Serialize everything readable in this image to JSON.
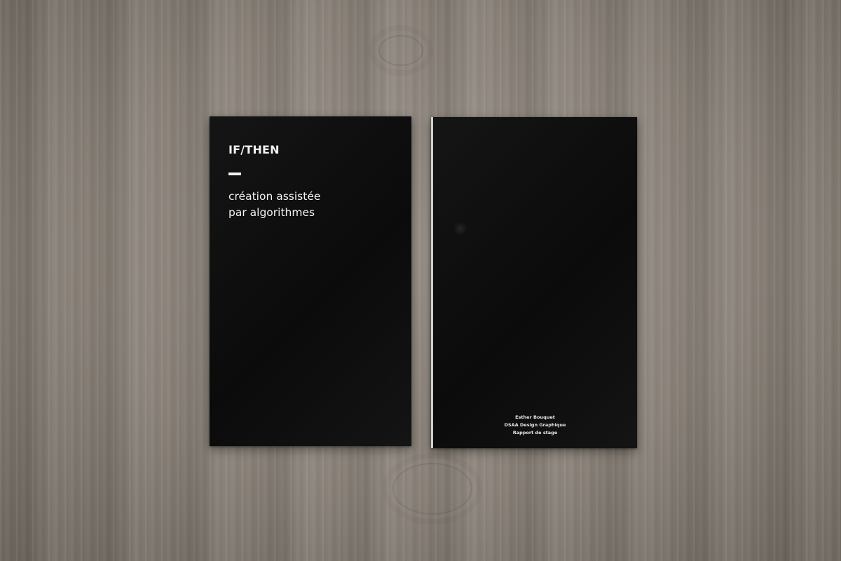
{
  "front_cover": {
    "title": "IF/THEN",
    "subtitle_lines": [
      "création assistée",
      "par algorithmes"
    ]
  },
  "back_cover": {
    "credit_lines": [
      "Esther Bouquet",
      "DSAA Design Graphique",
      "Rapport de stage"
    ]
  },
  "colors": {
    "cover": "#0e0e0e",
    "text": "#f2f2f2",
    "wood": "#8a8279"
  }
}
